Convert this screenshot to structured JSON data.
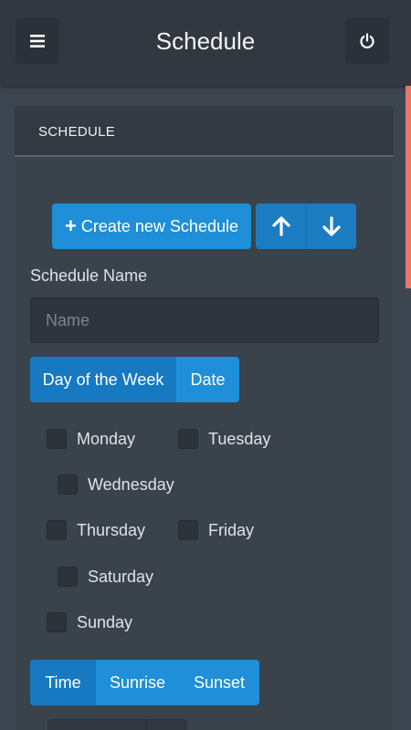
{
  "header": {
    "title": "Schedule",
    "menu_icon": "hamburger-menu-icon",
    "power_icon": "power-icon"
  },
  "panel": {
    "heading": "SCHEDULE",
    "create_button": "Create new Schedule",
    "name_label": "Schedule Name",
    "name_value": "",
    "name_placeholder": "Name",
    "mode_options": [
      "Day of the Week",
      "Date"
    ],
    "mode_selected": "Day of the Week",
    "days": [
      "Monday",
      "Tuesday",
      "Wednesday",
      "Thursday",
      "Friday",
      "Saturday",
      "Sunday"
    ],
    "days_checked": [],
    "time_options": [
      "Time",
      "Sunrise",
      "Sunset"
    ],
    "time_selected": "Time"
  },
  "colors": {
    "accent": "#1e8fd8",
    "accent_active": "#1679c2",
    "header_bg": "#31383f",
    "panel_bg": "#3a424b",
    "scroll_accent": "#e8776a"
  }
}
